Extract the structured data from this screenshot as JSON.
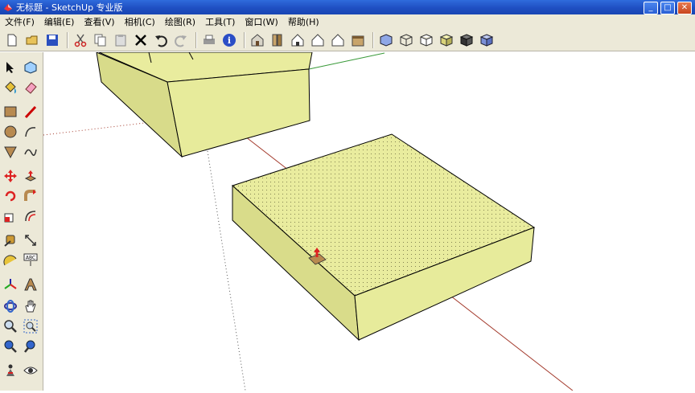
{
  "window": {
    "title": "无标题 - SketchUp 专业版"
  },
  "menu": [
    {
      "key": "file",
      "label": "文件(F)"
    },
    {
      "key": "edit",
      "label": "编辑(E)"
    },
    {
      "key": "view",
      "label": "查看(V)"
    },
    {
      "key": "camera",
      "label": "相机(C)"
    },
    {
      "key": "draw",
      "label": "绘图(R)"
    },
    {
      "key": "tools",
      "label": "工具(T)"
    },
    {
      "key": "window",
      "label": "窗口(W)"
    },
    {
      "key": "help",
      "label": "帮助(H)"
    }
  ],
  "toolbar": {
    "groups": [
      [
        "new-icon",
        "open-icon",
        "save-icon"
      ],
      [
        "cut-icon",
        "copy-icon",
        "paste-icon",
        "erase-icon",
        "undo-icon",
        "redo-icon"
      ],
      [
        "print-icon",
        "model-info-icon"
      ],
      [
        "iso-view-icon",
        "top-view-icon",
        "front-view-icon",
        "right-view-icon",
        "back-view-icon",
        "left-view-icon"
      ],
      [
        "xray-style-icon",
        "wireframe-style-icon",
        "hidden-line-style-icon",
        "shaded-style-icon",
        "textured-style-icon",
        "monochrome-style-icon"
      ]
    ]
  },
  "left_tools": [
    "select-icon",
    "component-icon",
    "paint-bucket-icon",
    "eraser-icon",
    "rectangle-icon",
    "line-icon",
    "circle-icon",
    "arc-icon",
    "polygon-icon",
    "freehand-icon",
    "move-icon",
    "push-pull-icon",
    "rotate-icon",
    "follow-me-icon",
    "scale-icon",
    "offset-icon",
    "tape-measure-icon",
    "dimension-icon",
    "protractor-icon",
    "text-icon",
    "axes-icon",
    "3d-text-icon",
    "orbit-icon",
    "pan-icon",
    "zoom-icon",
    "zoom-window-icon",
    "zoom-extents-icon",
    "previous-view-icon",
    "position-camera-icon",
    "look-around-icon"
  ],
  "colors": {
    "face": "#e9ec9e",
    "face_dark": "#d9dc8a",
    "edge": "#000000",
    "axis_red": "#a33a2c",
    "axis_green": "#3a9a3a"
  }
}
